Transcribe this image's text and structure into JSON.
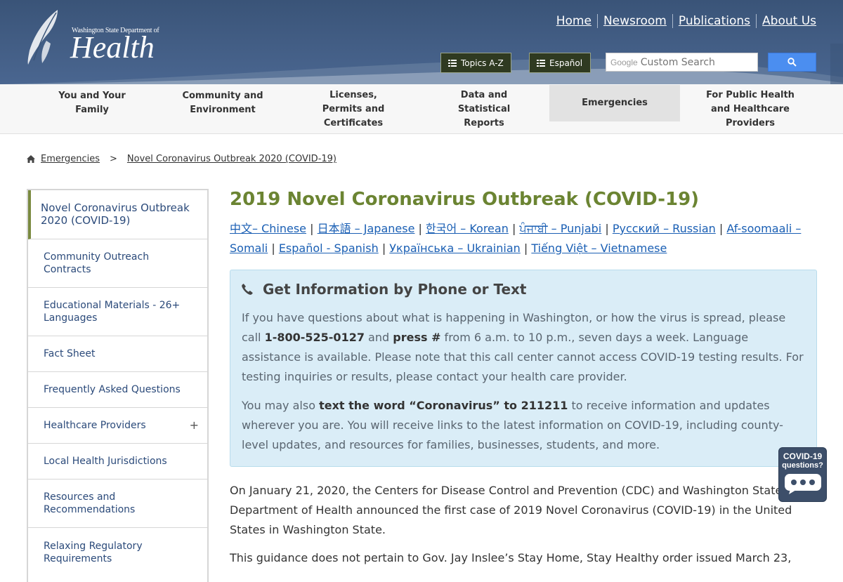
{
  "header": {
    "logo": {
      "small": "Washington State Department of",
      "big": "Health"
    },
    "top_links": [
      "Home",
      "Newsroom",
      "Publications",
      "About Us"
    ],
    "topics_button": "Topics A-Z",
    "espanol_button": "Español",
    "search": {
      "brand": "Google",
      "placeholder": "Custom Search",
      "icon": "search-icon"
    }
  },
  "nav": {
    "items": [
      {
        "label": "You and Your Family"
      },
      {
        "label": "Community and Environment"
      },
      {
        "label": "Licenses, Permits and Certificates"
      },
      {
        "label": "Data and Statistical Reports"
      },
      {
        "label": "Emergencies",
        "active": true
      },
      {
        "label": "For Public Health and Healthcare Providers"
      }
    ]
  },
  "breadcrumb": {
    "icon": "home-icon",
    "items": [
      "Emergencies",
      "Novel Coronavirus Outbreak 2020 (COVID-19)"
    ],
    "separator": ">"
  },
  "sidebar": {
    "heading": "Novel Coronavirus Outbreak 2020 (COVID-19)",
    "items": [
      {
        "label": "Community Outreach Contracts"
      },
      {
        "label": "Educational Materials - 26+ Languages"
      },
      {
        "label": "Fact Sheet"
      },
      {
        "label": "Frequently Asked Questions"
      },
      {
        "label": "Healthcare Providers",
        "expand": "+"
      },
      {
        "label": "Local Health Jurisdictions"
      },
      {
        "label": "Resources and Recommendations"
      },
      {
        "label": "Relaxing Regulatory Requirements"
      }
    ]
  },
  "main": {
    "title": "2019 Novel Coronavirus Outbreak (COVID-19)",
    "languages": [
      "中文– Chinese",
      "日本語 – Japanese",
      "한국어 – Korean",
      "ਪੰਜਾਬੀ – Punjabi",
      "Русский – Russian",
      "Af-soomaali – Somali",
      "Español - Spanish",
      "Українська – Ukrainian",
      "Tiếng Việt – Vietnamese"
    ],
    "language_separator": "|",
    "infobox": {
      "icon": "phone-icon",
      "title": "Get Information by Phone or Text",
      "p1_a": "If you have questions about what is happening in Washington, or how the virus is spread, please call ",
      "p1_phone": "1-800-525-0127",
      "p1_b": " and ",
      "p1_press": "press #",
      "p1_c": " from 6 a.m. to 10 p.m., seven days a week. Language assistance is available. Please note that this call center cannot access COVID-19 testing results. For testing inquiries or results, please contact your health care provider.",
      "p2_a": "You may also ",
      "p2_bold": "text the word “Coronavirus” to 211211",
      "p2_b": " to receive information and updates wherever you are. You will receive links to the latest information on COVID-19, including county-level updates, and resources for families, businesses, students, and more."
    },
    "body_p1": "On January 21, 2020, the Centers for Disease Control and Prevention (CDC) and Washington State Department of Health announced the first case of 2019 Novel Coronavirus (COVID-19) in the United States in Washington State.",
    "body_p2": "This guidance does not pertain to Gov. Jay Inslee’s Stay Home, Stay Healthy order issued March 23,"
  },
  "widget": {
    "line1": "COVID-19",
    "line2": "questions?",
    "icon": "chat-bubble-icon"
  },
  "colors": {
    "header": "#3a5478",
    "title_green": "#6b8432",
    "link_blue": "#1a5fb4",
    "infobox_bg": "#daedf7"
  }
}
